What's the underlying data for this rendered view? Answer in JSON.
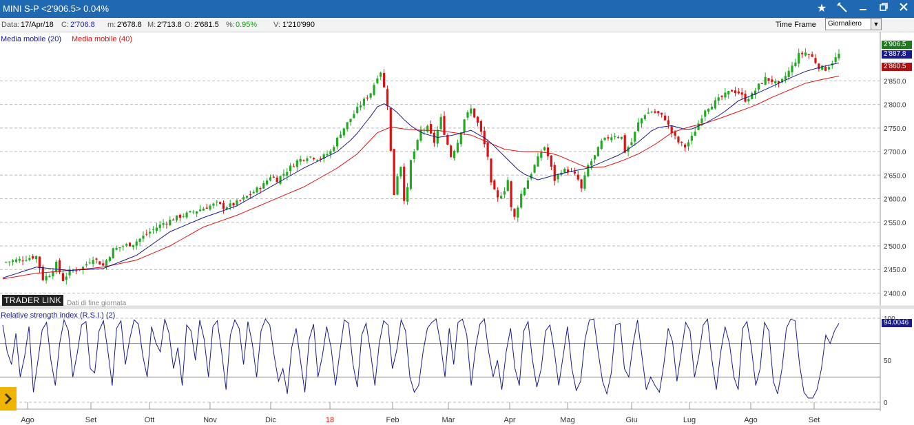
{
  "window": {
    "title": "MINI S-P <2'906.5> 0.04%",
    "icons": [
      "star-icon",
      "wand-icon",
      "minimize-icon",
      "restore-icon",
      "close-icon"
    ]
  },
  "info": {
    "date_label": "Data:",
    "date_value": "17/Apr/18",
    "close_label": "C:",
    "close_value": "2'706.8",
    "min_label": "m:",
    "min_value": "2'678.8",
    "max_label": "M:",
    "max_value": "2'713.8",
    "open_label": "O:",
    "open_value": "2'681.5",
    "pct_label": "%:",
    "pct_value": "0.95%",
    "vol_label": "V:",
    "vol_value": "1'210'990",
    "timeframe_label": "Time Frame",
    "timeframe_value": "Giornaliero"
  },
  "legend": {
    "ma20": "Media mobile (20)",
    "ma40": "Media mobile (40)"
  },
  "brand": {
    "name": "TRADER LINK",
    "subtitle": "Dati di fine giornata"
  },
  "rsi_title": "Relative strength index (R.S.I.) (2)",
  "price_tags": {
    "last": "2'906.5",
    "ma20": "2'887.8",
    "ma40": "2'860.5",
    "rsi": "94.0046"
  },
  "colors": {
    "up": "#22aa22",
    "down": "#dd1111",
    "ma20": "#1a1a8c",
    "ma40": "#dd1111",
    "rsi": "#1a1a8c",
    "titlebar": "#1f69b3"
  },
  "chart_data": {
    "type": "candlestick",
    "price_axis": {
      "ylim": [
        2370,
        2925
      ],
      "ticks": [
        "2'400.0",
        "2'450.0",
        "2'500.0",
        "2'550.0",
        "2'600.0",
        "2'650.0",
        "2'700.0",
        "2'750.0",
        "2'800.0",
        "2'850.0"
      ]
    },
    "rsi_axis": {
      "ylim": [
        0,
        100
      ],
      "ticks": [
        "0",
        "50",
        "100"
      ],
      "levels": [
        30,
        70
      ]
    },
    "months": [
      "Ago",
      "Set",
      "Ott",
      "Nov",
      "Dic",
      "18",
      "Feb",
      "Mar",
      "Apr",
      "Mag",
      "Giu",
      "Lug",
      "Ago",
      "Set"
    ],
    "price_path": [
      [
        0,
        2465
      ],
      [
        6,
        2472
      ],
      [
        10,
        2478
      ],
      [
        12,
        2430
      ],
      [
        14,
        2440
      ],
      [
        16,
        2462
      ],
      [
        18,
        2428
      ],
      [
        20,
        2446
      ],
      [
        22,
        2450
      ],
      [
        24,
        2455
      ],
      [
        27,
        2475
      ],
      [
        30,
        2458
      ],
      [
        33,
        2492
      ],
      [
        36,
        2500
      ],
      [
        39,
        2505
      ],
      [
        42,
        2520
      ],
      [
        45,
        2535
      ],
      [
        48,
        2548
      ],
      [
        52,
        2560
      ],
      [
        56,
        2570
      ],
      [
        60,
        2580
      ],
      [
        64,
        2590
      ],
      [
        66,
        2582
      ],
      [
        69,
        2588
      ],
      [
        72,
        2600
      ],
      [
        75,
        2615
      ],
      [
        78,
        2630
      ],
      [
        80,
        2648
      ],
      [
        82,
        2640
      ],
      [
        85,
        2660
      ],
      [
        88,
        2680
      ],
      [
        91,
        2690
      ],
      [
        93,
        2688
      ],
      [
        95,
        2685
      ],
      [
        98,
        2700
      ],
      [
        101,
        2740
      ],
      [
        104,
        2770
      ],
      [
        107,
        2800
      ],
      [
        110,
        2825
      ],
      [
        112,
        2860
      ],
      [
        113,
        2870
      ],
      [
        114,
        2835
      ],
      [
        115,
        2800
      ],
      [
        116,
        2700
      ],
      [
        117,
        2610
      ],
      [
        118,
        2650
      ],
      [
        119,
        2670
      ],
      [
        120,
        2600
      ],
      [
        121,
        2620
      ],
      [
        122,
        2680
      ],
      [
        123,
        2700
      ],
      [
        124,
        2720
      ],
      [
        125,
        2745
      ],
      [
        127,
        2750
      ],
      [
        129,
        2720
      ],
      [
        131,
        2770
      ],
      [
        132,
        2740
      ],
      [
        134,
        2690
      ],
      [
        136,
        2720
      ],
      [
        138,
        2770
      ],
      [
        140,
        2790
      ],
      [
        142,
        2760
      ],
      [
        143,
        2740
      ],
      [
        145,
        2690
      ],
      [
        146,
        2630
      ],
      [
        148,
        2600
      ],
      [
        150,
        2620
      ],
      [
        151,
        2640
      ],
      [
        152,
        2580
      ],
      [
        153,
        2560
      ],
      [
        155,
        2610
      ],
      [
        157,
        2640
      ],
      [
        159,
        2670
      ],
      [
        161,
        2700
      ],
      [
        162,
        2710
      ],
      [
        163,
        2690
      ],
      [
        165,
        2640
      ],
      [
        167,
        2660
      ],
      [
        169,
        2660
      ],
      [
        171,
        2650
      ],
      [
        172,
        2640
      ],
      [
        173,
        2620
      ],
      [
        175,
        2670
      ],
      [
        177,
        2690
      ],
      [
        179,
        2720
      ],
      [
        181,
        2730
      ],
      [
        183,
        2735
      ],
      [
        185,
        2730
      ],
      [
        186,
        2700
      ],
      [
        188,
        2720
      ],
      [
        190,
        2760
      ],
      [
        192,
        2780
      ],
      [
        194,
        2785
      ],
      [
        196,
        2780
      ],
      [
        198,
        2770
      ],
      [
        200,
        2740
      ],
      [
        202,
        2720
      ],
      [
        204,
        2710
      ],
      [
        206,
        2730
      ],
      [
        208,
        2760
      ],
      [
        210,
        2790
      ],
      [
        212,
        2800
      ],
      [
        214,
        2810
      ],
      [
        216,
        2820
      ],
      [
        218,
        2830
      ],
      [
        220,
        2825
      ],
      [
        222,
        2810
      ],
      [
        224,
        2820
      ],
      [
        226,
        2840
      ],
      [
        228,
        2855
      ],
      [
        230,
        2850
      ],
      [
        232,
        2840
      ],
      [
        234,
        2860
      ],
      [
        236,
        2880
      ],
      [
        238,
        2905
      ],
      [
        240,
        2910
      ],
      [
        242,
        2900
      ],
      [
        244,
        2880
      ],
      [
        246,
        2875
      ],
      [
        248,
        2890
      ],
      [
        250,
        2906
      ]
    ],
    "ma20_path": [
      [
        0,
        2432
      ],
      [
        10,
        2455
      ],
      [
        20,
        2448
      ],
      [
        30,
        2452
      ],
      [
        40,
        2480
      ],
      [
        50,
        2530
      ],
      [
        60,
        2560
      ],
      [
        70,
        2585
      ],
      [
        80,
        2625
      ],
      [
        90,
        2665
      ],
      [
        100,
        2700
      ],
      [
        105,
        2730
      ],
      [
        110,
        2775
      ],
      [
        113,
        2805
      ],
      [
        117,
        2790
      ],
      [
        121,
        2760
      ],
      [
        125,
        2740
      ],
      [
        130,
        2730
      ],
      [
        135,
        2735
      ],
      [
        140,
        2745
      ],
      [
        145,
        2725
      ],
      [
        150,
        2690
      ],
      [
        155,
        2655
      ],
      [
        160,
        2640
      ],
      [
        165,
        2650
      ],
      [
        170,
        2658
      ],
      [
        175,
        2665
      ],
      [
        180,
        2680
      ],
      [
        185,
        2695
      ],
      [
        190,
        2720
      ],
      [
        195,
        2750
      ],
      [
        200,
        2755
      ],
      [
        205,
        2745
      ],
      [
        210,
        2760
      ],
      [
        215,
        2780
      ],
      [
        220,
        2808
      ],
      [
        225,
        2822
      ],
      [
        230,
        2838
      ],
      [
        235,
        2855
      ],
      [
        240,
        2870
      ],
      [
        245,
        2880
      ],
      [
        250,
        2888
      ]
    ],
    "ma40_path": [
      [
        0,
        2430
      ],
      [
        10,
        2442
      ],
      [
        20,
        2448
      ],
      [
        30,
        2455
      ],
      [
        40,
        2470
      ],
      [
        50,
        2500
      ],
      [
        60,
        2540
      ],
      [
        70,
        2565
      ],
      [
        80,
        2595
      ],
      [
        90,
        2625
      ],
      [
        100,
        2665
      ],
      [
        106,
        2695
      ],
      [
        112,
        2740
      ],
      [
        116,
        2752
      ],
      [
        120,
        2748
      ],
      [
        125,
        2745
      ],
      [
        130,
        2745
      ],
      [
        135,
        2740
      ],
      [
        140,
        2735
      ],
      [
        145,
        2720
      ],
      [
        150,
        2705
      ],
      [
        155,
        2700
      ],
      [
        160,
        2700
      ],
      [
        165,
        2695
      ],
      [
        170,
        2680
      ],
      [
        175,
        2665
      ],
      [
        180,
        2668
      ],
      [
        185,
        2680
      ],
      [
        190,
        2695
      ],
      [
        195,
        2715
      ],
      [
        200,
        2740
      ],
      [
        205,
        2752
      ],
      [
        210,
        2760
      ],
      [
        215,
        2772
      ],
      [
        220,
        2785
      ],
      [
        225,
        2798
      ],
      [
        230,
        2815
      ],
      [
        235,
        2830
      ],
      [
        240,
        2845
      ],
      [
        245,
        2853
      ],
      [
        250,
        2860
      ]
    ],
    "rsi_values": [
      92,
      60,
      45,
      82,
      30,
      55,
      90,
      12,
      48,
      86,
      95,
      50,
      20,
      70,
      98,
      85,
      30,
      58,
      92,
      96,
      40,
      35,
      85,
      97,
      62,
      20,
      88,
      97,
      45,
      75,
      98,
      93,
      55,
      30,
      90,
      70,
      60,
      99,
      82,
      40,
      65,
      20,
      92,
      85,
      50,
      98,
      75,
      30,
      90,
      97,
      60,
      15,
      80,
      98,
      88,
      45,
      96,
      70,
      30,
      85,
      99,
      92,
      55,
      25,
      40,
      10,
      65,
      88,
      50,
      12,
      75,
      93,
      30,
      55,
      90,
      65,
      20,
      60,
      98,
      94,
      45,
      18,
      80,
      94,
      60,
      20,
      70,
      97,
      92,
      40,
      62,
      98,
      85,
      30,
      12,
      20,
      60,
      88,
      95,
      99,
      70,
      30,
      88,
      45,
      95,
      99,
      80,
      20,
      65,
      93,
      99,
      60,
      30,
      50,
      15,
      60,
      88,
      40,
      20,
      85,
      96,
      50,
      18,
      40,
      85,
      92,
      60,
      20,
      55,
      90,
      40,
      14,
      25,
      75,
      98,
      99,
      60,
      25,
      10,
      35,
      92,
      94,
      40,
      30,
      70,
      98,
      55,
      15,
      30,
      20,
      12,
      45,
      88,
      72,
      25,
      60,
      95,
      85,
      30,
      55,
      92,
      99,
      50,
      15,
      60,
      90,
      70,
      30,
      15,
      88,
      96,
      65,
      20,
      40,
      95,
      85,
      25,
      10,
      40,
      88,
      99,
      97,
      45,
      12,
      5,
      5,
      15,
      40,
      80,
      70,
      85,
      94
    ]
  }
}
